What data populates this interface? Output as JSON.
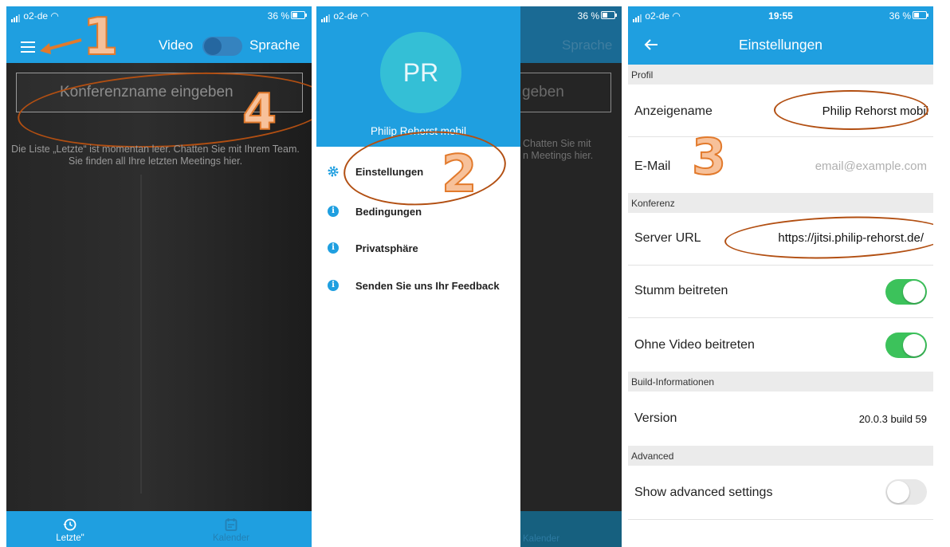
{
  "status_bar": {
    "carrier": "o2-de",
    "battery": "36 %",
    "time": "19:55"
  },
  "screen_recent": {
    "mode_video_label": "Video",
    "mode_audio_label": "Sprache",
    "conference_placeholder": "Konferenzname eingeben",
    "empty_text": "Die Liste „Letzte“ ist momentan leer. Chatten Sie mit Ihrem Team. Sie finden all Ihre letzten Meetings hier.",
    "tabs": [
      {
        "label": "Letzte\"",
        "icon": "history-icon"
      },
      {
        "label": "Kalender",
        "icon": "calendar-icon"
      }
    ]
  },
  "screen_drawer": {
    "avatar_initials": "PR",
    "display_name": "Philip Rehorst mobil",
    "menu": [
      {
        "label": "Einstellungen",
        "icon": "gear-icon"
      },
      {
        "label": "Bedingungen",
        "icon": "info-icon"
      },
      {
        "label": "Privatsphäre",
        "icon": "info-icon"
      },
      {
        "label": "Senden Sie uns Ihr Feedback",
        "icon": "info-icon"
      }
    ],
    "ghost_audio": "Sprache",
    "ghost_input": "geben",
    "ghost_text": "Chatten Sie mit\nn Meetings hier.",
    "ghost_tab": "Kalender"
  },
  "screen_settings": {
    "title": "Einstellungen",
    "sections": {
      "profile": "Profil",
      "conference": "Konferenz",
      "build": "Build-Informationen",
      "advanced": "Advanced"
    },
    "display_name_label": "Anzeigename",
    "display_name_value": "Philip Rehorst mobil",
    "email_label": "E-Mail",
    "email_placeholder": "email@example.com",
    "server_url_label": "Server URL",
    "server_url_value": "https://jitsi.philip-rehorst.de/",
    "join_muted_label": "Stumm beitreten",
    "join_muted": true,
    "join_no_video_label": "Ohne Video beitreten",
    "join_no_video": true,
    "version_label": "Version",
    "version_value": "20.0.3 build 59",
    "show_advanced_label": "Show advanced settings",
    "show_advanced": false
  },
  "annotations": [
    "1",
    "2",
    "3",
    "4"
  ],
  "colors": {
    "brand_blue": "#1f9fe0",
    "toggle_green": "#3cc25b",
    "annotation_orange": "#e27a2c",
    "ellipse_brown": "#b24f12"
  }
}
